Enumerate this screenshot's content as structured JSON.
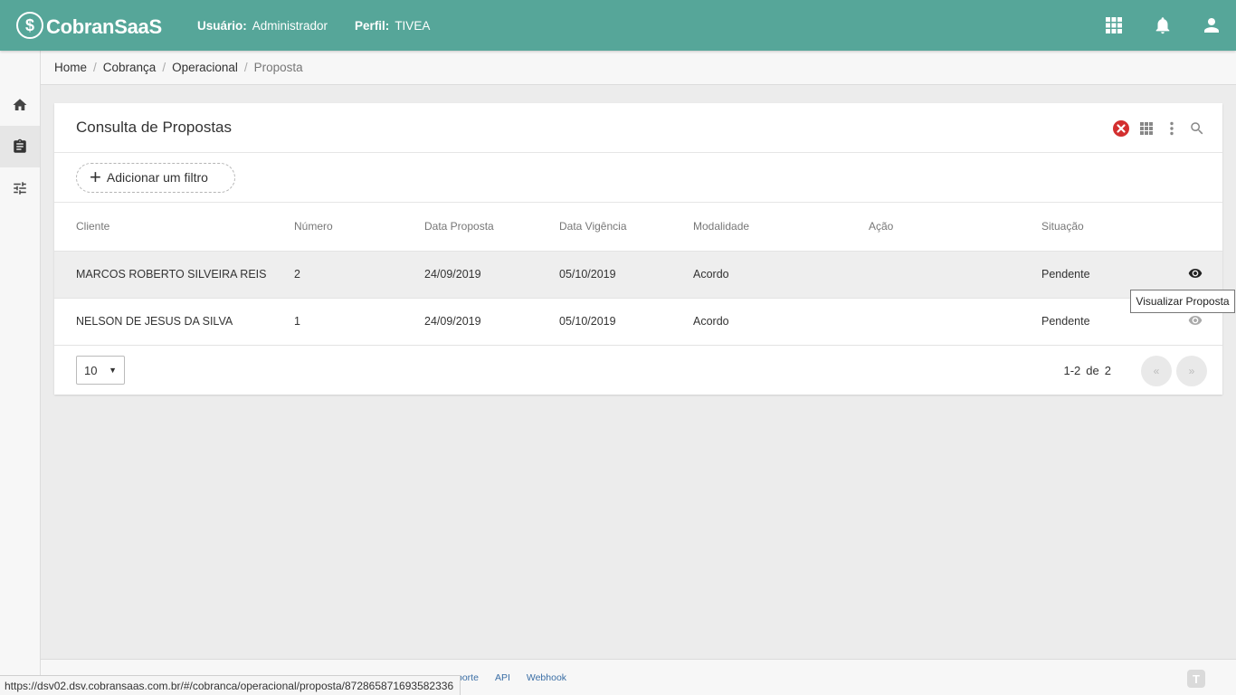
{
  "header": {
    "logo_mark": "$",
    "logo_text": "CobranSaaS",
    "user_key": "Usuário:",
    "user_value": "Administrador",
    "profile_key": "Perfil:",
    "profile_value": "TIVEA",
    "icons": [
      "apps-grid-icon",
      "bell-icon",
      "user-icon"
    ]
  },
  "sidebar": {
    "items": [
      {
        "name": "home",
        "icon": "home-icon"
      },
      {
        "name": "clipboard",
        "icon": "clipboard-icon",
        "active": true
      },
      {
        "name": "settings",
        "icon": "sliders-icon"
      }
    ]
  },
  "breadcrumb": {
    "items": [
      "Home",
      "Cobrança",
      "Operacional"
    ],
    "current": "Proposta"
  },
  "card": {
    "title": "Consulta de Propostas",
    "tools": [
      "clear-filter-icon",
      "columns-grid-icon",
      "more-vert-icon",
      "search-icon"
    ],
    "add_filter_label": "Adicionar um filtro"
  },
  "table": {
    "columns": [
      "Cliente",
      "Número",
      "Data Proposta",
      "Data Vigência",
      "Modalidade",
      "Ação",
      "Situação"
    ],
    "rows": [
      {
        "cliente": "MARCOS ROBERTO SILVEIRA REIS",
        "numero": "2",
        "data_proposta": "24/09/2019",
        "data_vigencia": "05/10/2019",
        "modalidade": "Acordo",
        "acao": "",
        "situacao": "Pendente"
      },
      {
        "cliente": "NELSON DE JESUS DA SILVA",
        "numero": "1",
        "data_proposta": "24/09/2019",
        "data_vigencia": "05/10/2019",
        "modalidade": "Acordo",
        "acao": "",
        "situacao": "Pendente"
      }
    ]
  },
  "pager": {
    "page_size": "10",
    "range": "1-2",
    "of_label": "de",
    "total": "2",
    "prev_label": "«",
    "next_label": "»"
  },
  "tooltip": "Visualizar Proposta",
  "footer": {
    "links": [
      "porte",
      "API",
      "Webhook"
    ],
    "logo_mark": "T"
  },
  "statusbar": "https://dsv02.dsv.cobransaas.com.br/#/cobranca/operacional/proposta/872865871693582336",
  "colors": {
    "header_bg": "#56a699",
    "clear_filter": "#d32f2f",
    "link": "#3a6ea5"
  }
}
